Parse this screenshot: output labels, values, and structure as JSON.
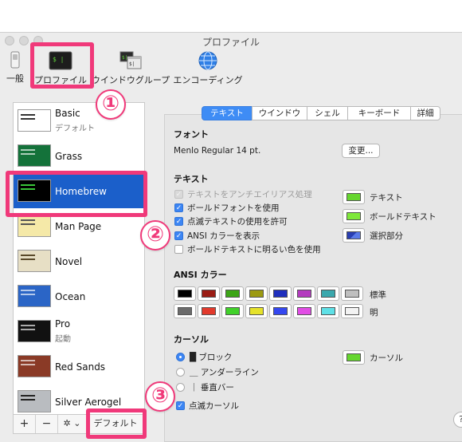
{
  "window": {
    "title": "プロファイル"
  },
  "toolbar": {
    "items": [
      {
        "label": "一般",
        "icon": "switch-icon"
      },
      {
        "label": "プロファイル",
        "icon": "terminal-icon"
      },
      {
        "label": "ウインドウグループ",
        "icon": "window-group-icon"
      },
      {
        "label": "エンコーディング",
        "icon": "globe-icon"
      }
    ]
  },
  "callouts": [
    "①",
    "②",
    "③"
  ],
  "profiles": [
    {
      "name": "Basic",
      "sub": "デフォルト",
      "color": "#ffffff"
    },
    {
      "name": "Grass",
      "sub": "",
      "color": "#14723a"
    },
    {
      "name": "Homebrew",
      "sub": "",
      "color": "#000000"
    },
    {
      "name": "Man Page",
      "sub": "",
      "color": "#f5e9a8"
    },
    {
      "name": "Novel",
      "sub": "",
      "color": "#e7dfc5"
    },
    {
      "name": "Ocean",
      "sub": "",
      "color": "#2b65c6"
    },
    {
      "name": "Pro",
      "sub": "起動",
      "color": "#111111"
    },
    {
      "name": "Red Sands",
      "sub": "",
      "color": "#8a3a26"
    },
    {
      "name": "Silver Aerogel",
      "sub": "",
      "color": "#b9bcc0"
    }
  ],
  "sidebar_footer": {
    "add": "+",
    "remove": "−",
    "gear": "✲ ⌄",
    "default_label": "デフォルト"
  },
  "tabs": [
    "テキスト",
    "ウインドウ",
    "シェル",
    "キーボード",
    "詳細"
  ],
  "font_section": {
    "title": "フォント",
    "value": "Menlo Regular 14 pt.",
    "change_button": "変更..."
  },
  "text_section": {
    "title": "テキスト",
    "options": [
      {
        "label": "テキストをアンチエイリアス処理",
        "checked": true,
        "disabled": true
      },
      {
        "label": "ボールドフォントを使用",
        "checked": true,
        "disabled": false
      },
      {
        "label": "点滅テキストの使用を許可",
        "checked": true,
        "disabled": false
      },
      {
        "label": "ANSI カラーを表示",
        "checked": true,
        "disabled": false
      },
      {
        "label": "ボールドテキストに明るい色を使用",
        "checked": false,
        "disabled": false
      }
    ],
    "colors": [
      {
        "label": "テキスト",
        "color": "#66d62f"
      },
      {
        "label": "ボールドテキスト",
        "color": "#7ee83a"
      },
      {
        "label": "選択部分",
        "color": "#2a3fb2"
      }
    ]
  },
  "ansi_section": {
    "title": "ANSI カラー",
    "normal_label": "標準",
    "bright_label": "明",
    "normal": [
      "#000000",
      "#9a1c14",
      "#3ca516",
      "#9c9a12",
      "#1f2fbd",
      "#b43bbf",
      "#3ba8ad",
      "#bfbfbf"
    ],
    "bright": [
      "#6b6b6b",
      "#e23a2c",
      "#41d12a",
      "#e5e22a",
      "#3447f0",
      "#e14de5",
      "#5ee0e6",
      "#f3f3f3"
    ]
  },
  "cursor_section": {
    "title": "カーソル",
    "options": [
      {
        "label": "█ ブロック",
        "selected": true
      },
      {
        "label": "＿ アンダーライン",
        "selected": false
      },
      {
        "label": "｜ 垂直バー",
        "selected": false
      }
    ],
    "blink_label": "点滅カーソル",
    "blink_checked": true,
    "color_label": "カーソル",
    "color": "#66d62f"
  },
  "help": "?"
}
